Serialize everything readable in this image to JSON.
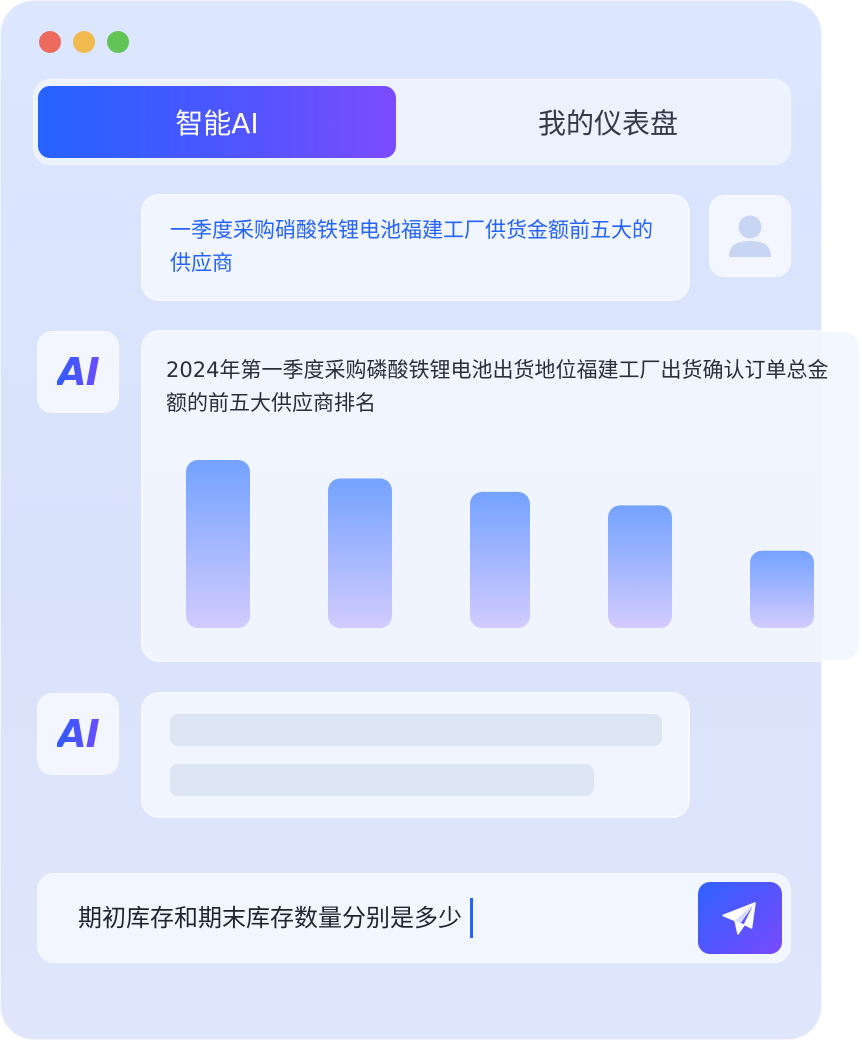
{
  "tabs": {
    "active_label": "智能AI",
    "inactive_label": "我的仪表盘"
  },
  "user_message": {
    "text": "一季度采购硝酸铁锂电池福建工厂供货金额前五大的供应商"
  },
  "ai_response": {
    "avatar_label": "AI",
    "chart_title": "2024年第一季度采购磷酸铁锂电池出货地位福建工厂出货确认订单总金额的前五大供应商排名"
  },
  "ai_loading": {
    "avatar_label": "AI"
  },
  "chart_data": {
    "type": "bar",
    "title": "2024年第一季度采购磷酸铁锂电池出货地位福建工厂出货确认订单总金额的前五大供应商排名",
    "categories": [
      "",
      "",
      "",
      "",
      ""
    ],
    "values": [
      100,
      89,
      81,
      73,
      46
    ],
    "ylim": [
      0,
      100
    ],
    "grid": false,
    "colors": {
      "top": "#74a2ff",
      "bottom": "#d2cbff"
    }
  },
  "input": {
    "value": "期初库存和期末库存数量分别是多少"
  },
  "icons": {
    "send": "paper-plane-icon",
    "user": "user-icon"
  },
  "colors": {
    "accent": "#2563ff",
    "accent_end": "#7b4cff"
  }
}
